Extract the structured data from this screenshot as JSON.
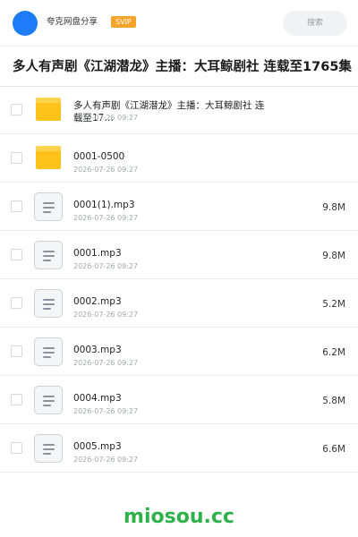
{
  "header": {
    "user_name": "夸克网盘分享",
    "badge": "SVIP",
    "search_placeholder": "搜索"
  },
  "title": "多人有声剧《江湖潜龙》主播：大耳鲸剧社 连载至1765集",
  "items": [
    {
      "type": "folder",
      "name": "多人有声剧《江湖潜龙》主播：大耳鲸剧社 连载至17…",
      "date": "2026-07-26 09:27",
      "size": ""
    },
    {
      "type": "folder",
      "name": "0001-0500",
      "date": "2026-07-26 09:27",
      "size": ""
    },
    {
      "type": "file",
      "name": "0001(1).mp3",
      "date": "2026-07-26 09:27",
      "size": "9.8M"
    },
    {
      "type": "file",
      "name": "0001.mp3",
      "date": "2026-07-26 09:27",
      "size": "9.8M"
    },
    {
      "type": "file",
      "name": "0002.mp3",
      "date": "2026-07-26 09:27",
      "size": "5.2M"
    },
    {
      "type": "file",
      "name": "0003.mp3",
      "date": "2026-07-26 09:27",
      "size": "6.2M"
    },
    {
      "type": "file",
      "name": "0004.mp3",
      "date": "2026-07-26 09:27",
      "size": "5.8M"
    },
    {
      "type": "file",
      "name": "0005.mp3",
      "date": "2026-07-26 09:27",
      "size": "6.6M"
    }
  ],
  "watermark": "miosou.cc",
  "colors": {
    "avatar": "#1e7cf8",
    "badge": "#f6a32b",
    "folder": "#ffc21a",
    "watermark": "#2db24a"
  }
}
